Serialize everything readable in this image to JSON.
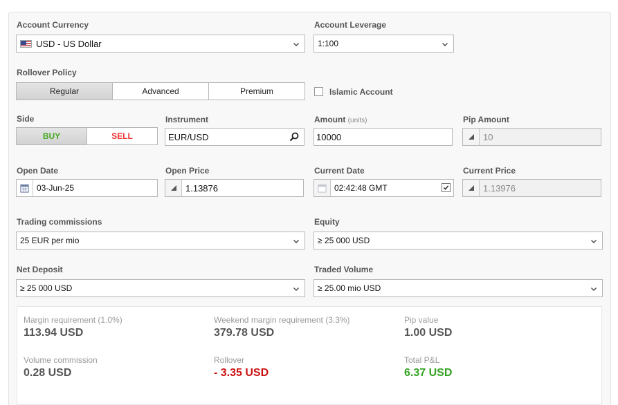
{
  "account_currency": {
    "label": "Account Currency",
    "value": "USD - US Dollar",
    "flag_icon": "us-flag-icon"
  },
  "account_leverage": {
    "label": "Account Leverage",
    "value": "1:100"
  },
  "rollover_policy": {
    "label": "Rollover Policy",
    "options": [
      "Regular",
      "Advanced",
      "Premium"
    ],
    "selected": "Regular"
  },
  "islamic_account": {
    "label": "Islamic Account",
    "checked": false
  },
  "side": {
    "label": "Side",
    "buy": "BUY",
    "sell": "SELL",
    "buy_color": "#44aa22",
    "sell_color": "#ee3333",
    "selected": "BUY"
  },
  "instrument": {
    "label": "Instrument",
    "value": "EUR/USD"
  },
  "amount": {
    "label": "Amount",
    "unit_label": "(units)",
    "value": "10000"
  },
  "pip_amount": {
    "label": "Pip Amount",
    "value": "10"
  },
  "open_date": {
    "label": "Open Date",
    "value": "03-Jun-25"
  },
  "open_price": {
    "label": "Open Price",
    "value": "1.13876"
  },
  "current_date": {
    "label": "Current Date",
    "value": "02:42:48 GMT",
    "checked": true
  },
  "current_price": {
    "label": "Current Price",
    "value": "1.13976"
  },
  "trading_commissions": {
    "label": "Trading commissions",
    "value": "25 EUR per mio"
  },
  "equity": {
    "label": "Equity",
    "value": "≥ 25 000 USD"
  },
  "net_deposit": {
    "label": "Net Deposit",
    "value": "≥ 25 000 USD"
  },
  "traded_volume": {
    "label": "Traded Volume",
    "value": "≥ 25.00 mio USD"
  },
  "results": {
    "margin_requirement": {
      "label": "Margin requirement (1.0%)",
      "value": "113.94 USD"
    },
    "weekend_margin": {
      "label": "Weekend margin requirement (3.3%)",
      "value": "379.78 USD"
    },
    "pip_value": {
      "label": "Pip value",
      "value": "1.00 USD"
    },
    "volume_commission": {
      "label": "Volume commission",
      "value": "0.28 USD"
    },
    "rollover": {
      "label": "Rollover",
      "value": "- 3.35 USD",
      "color": "#cc1111"
    },
    "total_pl": {
      "label": "Total P&L",
      "value": "6.37 USD",
      "color": "#33a322"
    }
  }
}
